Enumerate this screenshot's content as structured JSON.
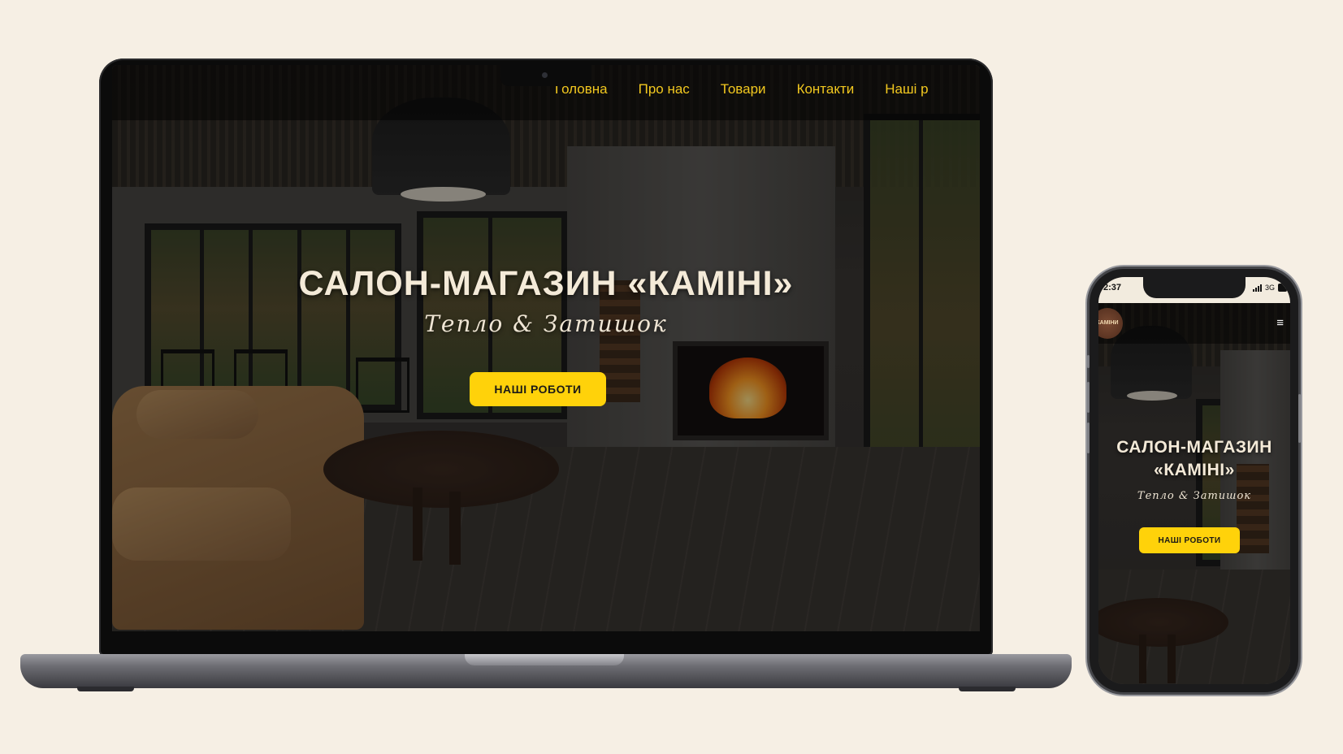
{
  "desktop": {
    "nav": [
      "Головна",
      "Про нас",
      "Товари",
      "Контакти",
      "Наші р"
    ],
    "hero_title": "САЛОН-МАГАЗИН «КАМІНІ»",
    "hero_subtitle": "Тепло & Затишок",
    "cta_label": "НАШІ РОБОТИ"
  },
  "mobile": {
    "status_time": "2:37",
    "network": "3G",
    "logo_text": "КАМІНИ",
    "hero_title_line1": "САЛОН-МАГАЗИН",
    "hero_title_line2": "«КАМІНІ»",
    "hero_subtitle": "Тепло & Затишок",
    "cta_label": "НАШІ РОБОТИ"
  },
  "colors": {
    "background": "#f6efe4",
    "nav_text": "#f2c81f",
    "cta": "#ffd20a",
    "hero_text": "#f4ead8"
  },
  "icons": [
    "hamburger-menu-icon",
    "signal-icon",
    "battery-icon",
    "camera-icon"
  ]
}
